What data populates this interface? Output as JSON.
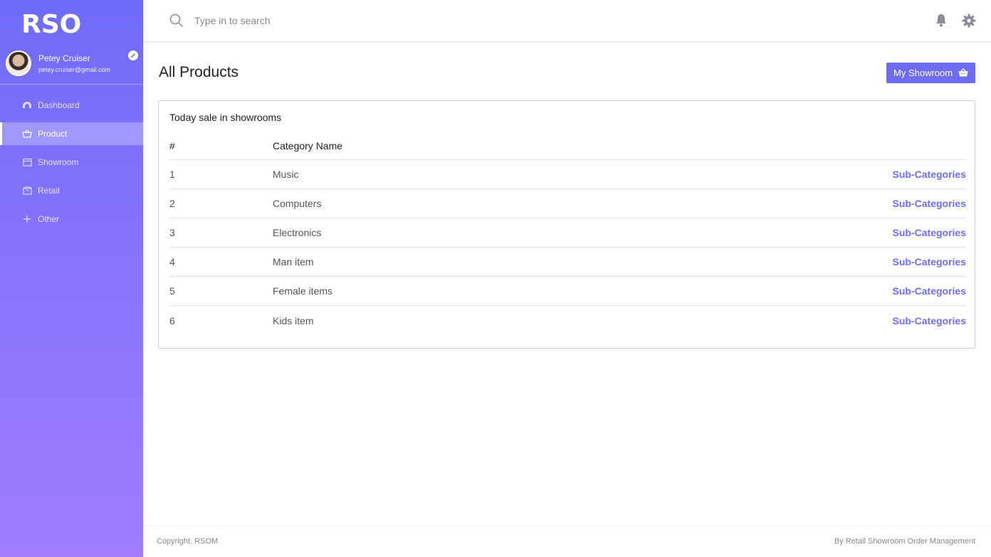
{
  "sidebar": {
    "logo": "RSO",
    "user": {
      "name": "Petey Cruiser",
      "email": "petey.cruiser@gmail.com"
    },
    "items": [
      {
        "label": "Dashboard",
        "icon": "gauge-icon",
        "active": false
      },
      {
        "label": "Product",
        "icon": "basket-icon",
        "active": true
      },
      {
        "label": "Showroom",
        "icon": "store-icon",
        "active": false
      },
      {
        "label": "Retail",
        "icon": "box-icon",
        "active": false
      },
      {
        "label": "Other",
        "icon": "plus-icon",
        "active": false
      }
    ]
  },
  "header": {
    "search_placeholder": "Type in to search",
    "icons": [
      "search-icon",
      "bell-icon",
      "gear-icon"
    ]
  },
  "main": {
    "title": "All Products",
    "action_button": "My Showroom",
    "card": {
      "title": "Today sale in showrooms",
      "columns": [
        "#",
        "Category Name"
      ],
      "rows": [
        {
          "num": "1",
          "name": "Music",
          "link": "Sub-Categories"
        },
        {
          "num": "2",
          "name": "Computers",
          "link": "Sub-Categories"
        },
        {
          "num": "3",
          "name": "Electronics",
          "link": "Sub-Categories"
        },
        {
          "num": "4",
          "name": "Man item",
          "link": "Sub-Categories"
        },
        {
          "num": "5",
          "name": "Female items",
          "link": "Sub-Categories"
        },
        {
          "num": "6",
          "name": "Kids item",
          "link": "Sub-Categories"
        }
      ]
    }
  },
  "footer": {
    "left": "Copyright. RSOM",
    "right": "By Retail Showroom Order Management"
  },
  "colors": {
    "accent": "#6f6cf6",
    "sidebar_top": "#6e6cf9",
    "sidebar_bottom": "#a07cfd"
  }
}
